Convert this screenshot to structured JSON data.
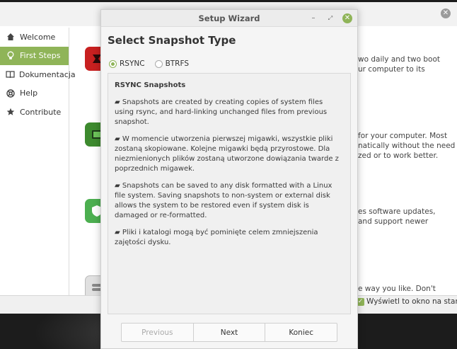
{
  "background_window": {
    "sidebar": {
      "items": [
        {
          "label": "Welcome",
          "icon": "home-icon",
          "active": false
        },
        {
          "label": "First Steps",
          "icon": "lightbulb-icon",
          "active": true
        },
        {
          "label": "Dokumentacja",
          "icon": "book-icon",
          "active": false
        },
        {
          "label": "Help",
          "icon": "lifebuoy-icon",
          "active": false
        },
        {
          "label": "Contribute",
          "icon": "star-icon",
          "active": false
        }
      ]
    },
    "content_fragments": {
      "f1_line1": "wo daily and two boot",
      "f1_line2": "ur computer to its",
      "f2_line1": "for your computer. Most",
      "f2_line2": "natically without the need",
      "f2_line3": "zed or to work better.",
      "f3_line1": "es software updates,",
      "f3_line2": "and support newer",
      "f4_line1": "e way you like. Don't"
    },
    "startup_checkbox_label": "Wyświetl to okno na starcie"
  },
  "dialog": {
    "title": "Setup Wizard",
    "heading": "Select Snapshot Type",
    "radio_options": [
      {
        "label": "RSYNC",
        "selected": true
      },
      {
        "label": "BTRFS",
        "selected": false
      }
    ],
    "description": {
      "title": "RSYNC Snapshots",
      "paragraphs": [
        "▰ Snapshots are created by creating copies of system files using rsync, and hard-linking unchanged files from previous snapshot.",
        "▰ W momencie utworzenia pierwszej migawki, wszystkie pliki zostaną skopiowane. Kolejne migawki będą przyrostowe. Dla niezmienionych plików zostaną utworzone dowiązania twarde z poprzednich migawek.",
        "▰ Snapshots can be saved to any disk formatted with a Linux file system. Saving snapshots to non-system or external disk allows the system to be restored even if system disk is damaged or re-formatted.",
        "▰ Pliki i katalogi mogą być pominięte celem zmniejszenia zajętości dysku."
      ]
    },
    "buttons": {
      "previous": "Previous",
      "next": "Next",
      "finish": "Koniec"
    }
  },
  "colors": {
    "accent": "#8fb458"
  }
}
